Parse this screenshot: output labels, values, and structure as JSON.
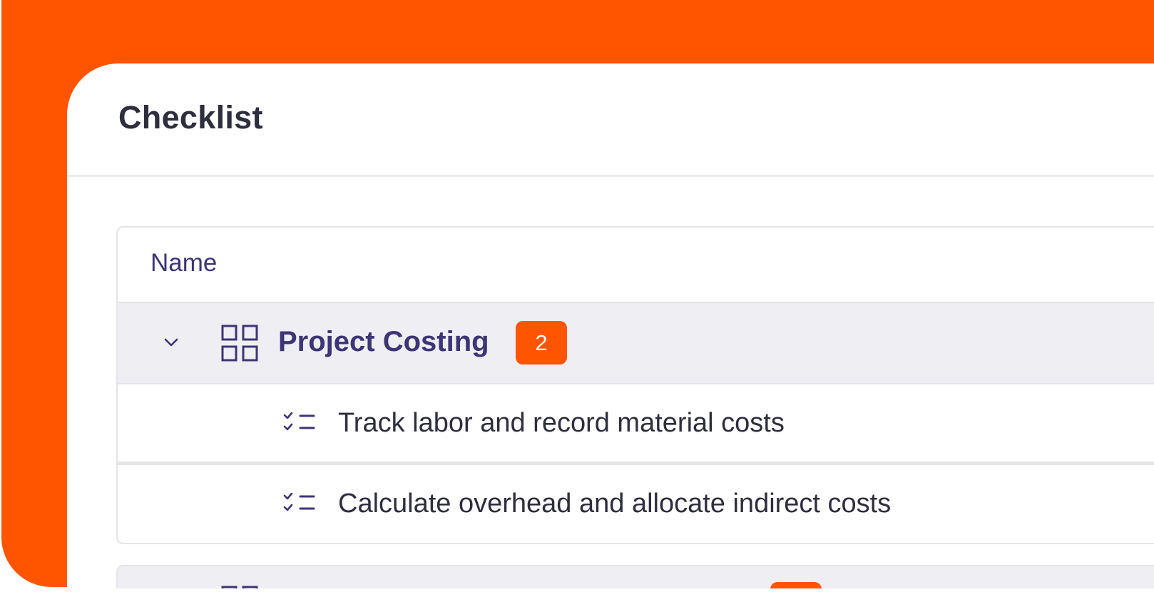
{
  "panel": {
    "title": "Checklist"
  },
  "table": {
    "column_header": "Name",
    "group": {
      "label": "Project Costing",
      "count": "2",
      "expand_icon": "chevron-down-icon",
      "group_icon": "grid-icon"
    },
    "tasks": [
      {
        "label": "Track labor and record material costs",
        "icon": "checklist-icon"
      },
      {
        "label": "Calculate overhead and allocate indirect costs",
        "icon": "checklist-icon"
      }
    ]
  },
  "colors": {
    "accent": "#FF5500",
    "text_primary": "#2E2E3F",
    "text_indigo": "#3D3575",
    "row_highlight": "#EEEEF3",
    "border": "#E4E4EC"
  }
}
